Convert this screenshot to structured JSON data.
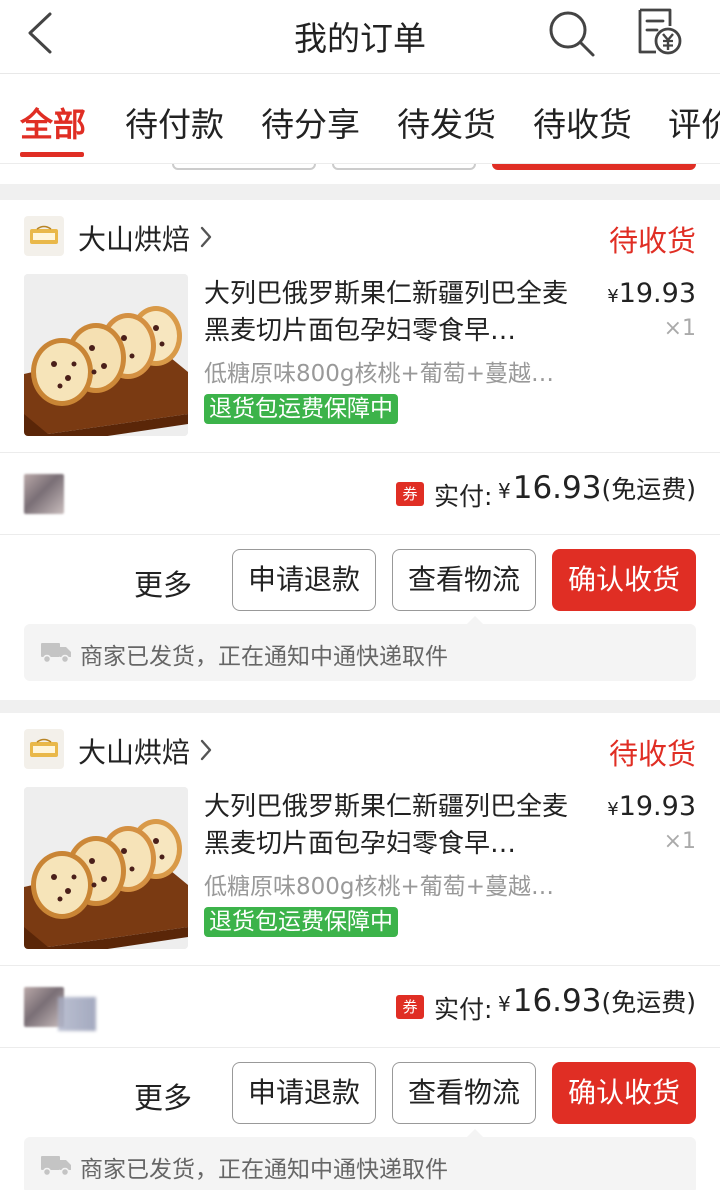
{
  "header": {
    "title": "我的订单",
    "back_icon": "back-arrow-icon",
    "search_icon": "search-icon",
    "bill_icon": "bill-yuan-icon"
  },
  "tabs": [
    {
      "label": "全部",
      "active": true
    },
    {
      "label": "待付款"
    },
    {
      "label": "待分享"
    },
    {
      "label": "待发货"
    },
    {
      "label": "待收货"
    },
    {
      "label": "评价"
    }
  ],
  "colors": {
    "accent": "#e02e24",
    "guarantee": "#3cb34a"
  },
  "orders": [
    {
      "store": "大山烘焙",
      "status": "待收货",
      "product_title": "大列巴俄罗斯果仁新疆列巴全麦黑麦切片面包孕妇零食早…",
      "product_spec": "低糖原味800g核桃+葡萄+蔓越…",
      "guarantee": "退货包运费保障中",
      "price_symbol": "¥",
      "price": "19.93",
      "qty": "×1",
      "coupon": "券",
      "paid_label": "实付:",
      "paid_symbol": "¥",
      "paid_amount": "16.93",
      "shipping": "(免运费)",
      "more": "更多",
      "btn_refund": "申请退款",
      "btn_logistics": "查看物流",
      "btn_confirm": "确认收货",
      "notice": "商家已发货，正在通知中通快递取件"
    },
    {
      "store": "大山烘焙",
      "status": "待收货",
      "product_title": "大列巴俄罗斯果仁新疆列巴全麦黑麦切片面包孕妇零食早…",
      "product_spec": "低糖原味800g核桃+葡萄+蔓越…",
      "guarantee": "退货包运费保障中",
      "price_symbol": "¥",
      "price": "19.93",
      "qty": "×1",
      "coupon": "券",
      "paid_label": "实付:",
      "paid_symbol": "¥",
      "paid_amount": "16.93",
      "shipping": "(免运费)",
      "more": "更多",
      "btn_refund": "申请退款",
      "btn_logistics": "查看物流",
      "btn_confirm": "确认收货",
      "notice": "商家已发货，正在通知中通快递取件"
    }
  ]
}
